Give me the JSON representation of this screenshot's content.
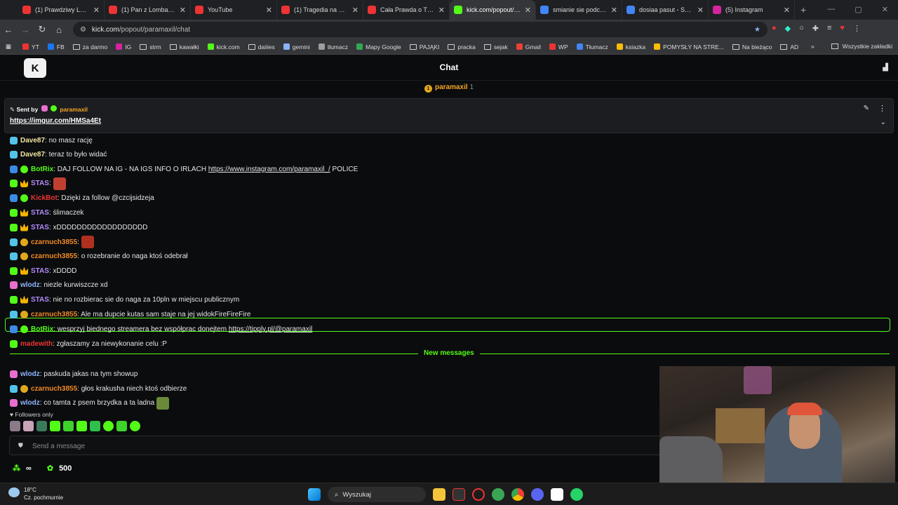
{
  "browser": {
    "tabs": [
      {
        "title": "(1) Prawdziwy Lomba",
        "fav": "#e33"
      },
      {
        "title": "(1) Pan z Lombardu -",
        "fav": "#e33"
      },
      {
        "title": "YouTube",
        "fav": "#e33"
      },
      {
        "title": "(1) Tragedia na krako",
        "fav": "#e33"
      },
      {
        "title": "Cała Prawda o TRZEZ",
        "fav": "#e33"
      },
      {
        "title": "kick.com/popout/par",
        "fav": "#53fc18"
      },
      {
        "title": "smianie sie podczas p",
        "fav": "#4285f4"
      },
      {
        "title": "dosiaa pasut - Szukaj",
        "fav": "#4285f4"
      },
      {
        "title": "(5) Instagram",
        "fav": "#d6249f"
      }
    ],
    "url_host": "kick.com",
    "url_path": "/popout/paramaxil/chat",
    "bookmarks": [
      {
        "label": "YT",
        "color": "#e33",
        "kind": "icon"
      },
      {
        "label": "FB",
        "color": "#1877f2",
        "kind": "icon"
      },
      {
        "label": "za darmo",
        "kind": "folder"
      },
      {
        "label": "IG",
        "color": "#d6249f",
        "kind": "icon"
      },
      {
        "label": "strm",
        "kind": "folder"
      },
      {
        "label": "kawałki",
        "kind": "folder"
      },
      {
        "label": "kick.com",
        "color": "#53fc18",
        "kind": "icon"
      },
      {
        "label": "daiiies",
        "kind": "folder"
      },
      {
        "label": "gemini",
        "color": "#8ab4f8",
        "kind": "icon"
      },
      {
        "label": "tłumacz",
        "color": "#9e9e9e",
        "kind": "icon"
      },
      {
        "label": "Mapy Google",
        "color": "#34a853",
        "kind": "icon"
      },
      {
        "label": "PAJĄKI",
        "kind": "folder"
      },
      {
        "label": "pracka",
        "kind": "folder"
      },
      {
        "label": "sejak",
        "kind": "folder"
      },
      {
        "label": "Gmail",
        "color": "#ea4335",
        "kind": "icon"
      },
      {
        "label": "WP",
        "color": "#e33",
        "kind": "icon"
      },
      {
        "label": "Tłumacz",
        "color": "#4285f4",
        "kind": "icon"
      },
      {
        "label": "ksiazka",
        "color": "#fbbc05",
        "kind": "icon"
      },
      {
        "label": "POMYSŁY NA STRE...",
        "color": "#fbbc05",
        "kind": "icon"
      },
      {
        "label": "Na bieżąco",
        "kind": "folder"
      },
      {
        "label": "AD",
        "kind": "folder"
      }
    ],
    "all_bookmarks": "Wszystkie zakładki"
  },
  "chat": {
    "logo": "K",
    "title": "Chat",
    "sub_user": "paramaxil",
    "sub_count": "1",
    "pinned": {
      "sent_by_label": "Sent by",
      "sender": "paramaxil",
      "link": "https://imgur.com/HMSa4Et"
    },
    "messages": [
      {
        "user": "Dave87",
        "color": "#f0e6a0",
        "badges": [
          "sub"
        ],
        "text": ": no masz rację",
        "emote": ""
      },
      {
        "user": "Dave87",
        "color": "#f0e6a0",
        "badges": [
          "sub"
        ],
        "text": ": teraz to było widać",
        "emote": ""
      },
      {
        "user": "BotRix",
        "color": "#53fc18",
        "badges": [
          "bot",
          "ver"
        ],
        "text": ": DAJ FOLLOW NA IG - NA IGS INFO O IRLACH ",
        "link": "https://www.instagram.com/paramaxil_/",
        "after": " POLICE",
        "emote": ""
      },
      {
        "user": "STAS",
        "color": "#b58cff",
        "badges": [
          "grn",
          "crown"
        ],
        "text": ":",
        "emote": "#c04030"
      },
      {
        "user": "KickBot",
        "color": "#e33",
        "badges": [
          "bot",
          "ver"
        ],
        "text": ": Dzięki za follow @czcijsidzeja",
        "emote": ""
      },
      {
        "user": "STAS",
        "color": "#b58cff",
        "badges": [
          "grn",
          "crown"
        ],
        "text": ": ślimaczek",
        "emote": ""
      },
      {
        "user": "STAS",
        "color": "#b58cff",
        "badges": [
          "grn",
          "crown"
        ],
        "text": ": xDDDDDDDDDDDDDDDDDD",
        "emote": ""
      },
      {
        "user": "czarnuch3855",
        "color": "#f08a24",
        "badges": [
          "sub",
          "coin"
        ],
        "text": ":",
        "emote": "#b03020"
      },
      {
        "user": "czarnuch3855",
        "color": "#f08a24",
        "badges": [
          "sub",
          "coin"
        ],
        "text": ": o rozebranie do naga ktoś odebrał",
        "emote": ""
      },
      {
        "user": "STAS",
        "color": "#b58cff",
        "badges": [
          "grn",
          "crown"
        ],
        "text": ": xDDDD",
        "emote": ""
      },
      {
        "user": "wlodz",
        "color": "#8fb4ff",
        "badges": [
          "pink"
        ],
        "text": ": niezle kurwiszcze xd",
        "emote": ""
      },
      {
        "user": "STAS",
        "color": "#b58cff",
        "badges": [
          "grn",
          "crown"
        ],
        "text": ": nie no rozbierac sie do naga za 10pln w miejscu publicznym",
        "emote": ""
      },
      {
        "user": "czarnuch3855",
        "color": "#f08a24",
        "badges": [
          "sub",
          "coin"
        ],
        "text": ": Ale ma dupcie kutas sam staje na jej widokFireFireFire",
        "emote": ""
      },
      {
        "user": "BotRix",
        "color": "#53fc18",
        "badges": [
          "bot",
          "ver"
        ],
        "text": ": wesprzyj biednego streamera bez współprac donejtem ",
        "link": "https://tipply.pl/@paramaxil",
        "after": "",
        "emote": ""
      },
      {
        "user": "madewith",
        "color": "#e33",
        "badges": [
          "grn"
        ],
        "text": ": zgłaszamy za niewykonanie celu :P",
        "emote": ""
      }
    ],
    "new_messages_label": "New messages",
    "new_messages": [
      {
        "user": "wlodz",
        "color": "#8fb4ff",
        "badges": [
          "pink"
        ],
        "text": ": paskuda jakas na tym showup",
        "emote": ""
      },
      {
        "user": "czarnuch3855",
        "color": "#f08a24",
        "badges": [
          "sub",
          "coin"
        ],
        "text": ": głos krakusha niech ktoś odbierze",
        "emote": ""
      },
      {
        "user": "wlodz",
        "color": "#8fb4ff",
        "badges": [
          "pink"
        ],
        "text": ": co tamta z psem brzydka a ta ladna",
        "emote": "#6a8a3a"
      }
    ],
    "followers_only": "Followers only",
    "input_placeholder": "Send a message",
    "kicks_infinity": "∞",
    "points": "500"
  },
  "taskbar": {
    "temp": "18°C",
    "weather": "Cz. pochmurnie",
    "search_label": "Wyszukaj"
  }
}
